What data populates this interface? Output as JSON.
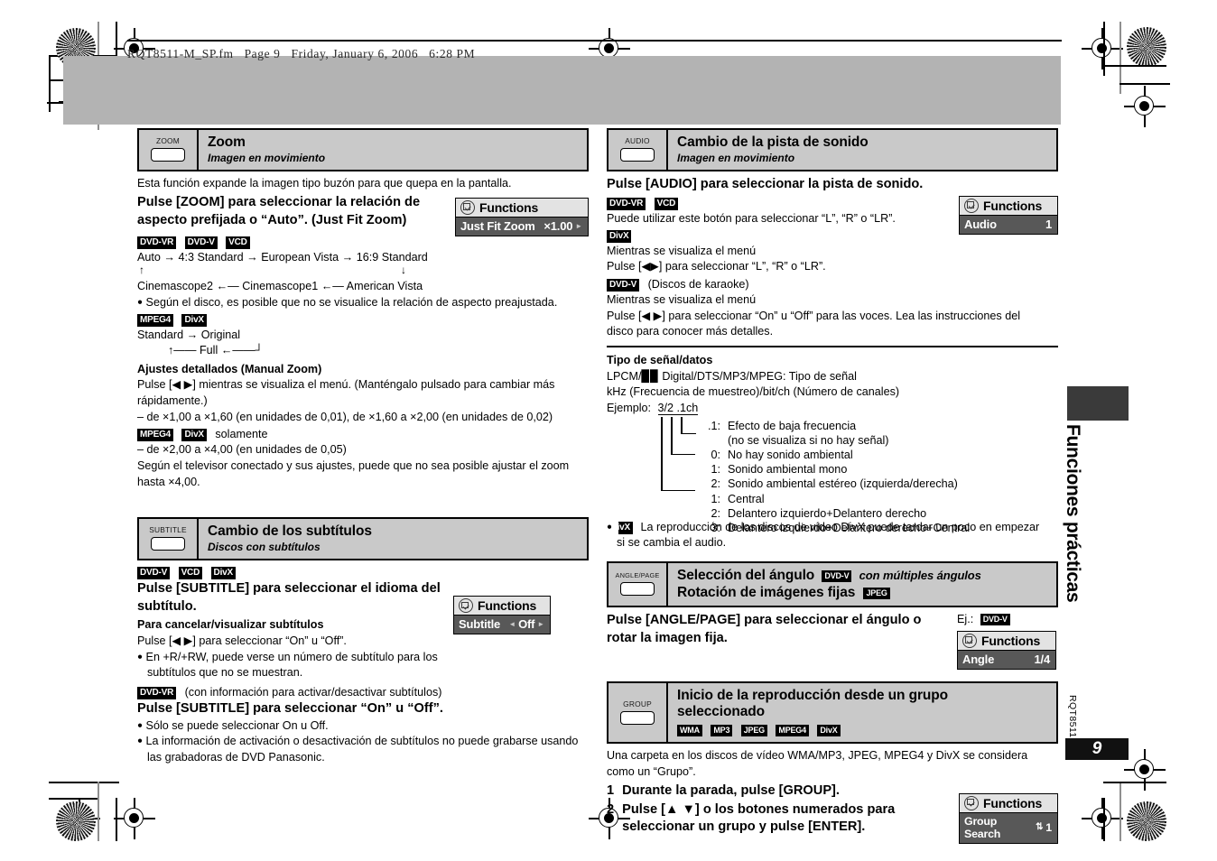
{
  "print_header": {
    "text": "RQT8511-M_SP.fm   Page 9   Friday, January 6, 2006   6:28 PM"
  },
  "sidebar": {
    "running_title": "Funciones prácticas",
    "doc_code": "RQT8511",
    "page_number": "9"
  },
  "sections": {
    "zoom": {
      "button_label": "ZOOM",
      "title": "Zoom",
      "subtitle": "Imagen en movimiento",
      "intro": "Esta función expande la imagen tipo buzón para que quepa en la pantalla.",
      "instruction_line1": "Pulse [ZOOM] para seleccionar la relación de",
      "instruction_line2": "aspecto prefijada o “Auto”. (Just Fit Zoom)",
      "badges_1": [
        "DVD-VR",
        "DVD-V",
        "VCD"
      ],
      "flow_top": "Auto → 4:3 Standard → European Vista → 16:9 Standard",
      "flow_bottom": "Cinemascope2 ←— Cinemascope1 ←— American Vista",
      "note_disc": "Según el disco, es posible que no se visualice la relación de aspecto preajustada.",
      "badges_2": [
        "MPEG4",
        "DivX"
      ],
      "flow_mpeg_top": "Standard → Original",
      "flow_mpeg_bottom": "Full",
      "manual_heading": "Ajustes detallados (Manual Zoom)",
      "manual_line1": "Pulse [◀ ▶] mientras se visualiza el menú. (Manténgalo pulsado para cambiar más",
      "manual_line2": "rápidamente.)",
      "range_1": "– de ×1,00 a ×1,60 (en unidades de 0,01), de ×1,60 a ×2,00 (en unidades de 0,02)",
      "badges_3": [
        "MPEG4",
        "DivX"
      ],
      "badges_3_suffix": "solamente",
      "range_2": "– de ×2,00 a ×4,00 (en unidades de 0,05)",
      "tv_note_line1": "Según el televisor conectado y sus ajustes, puede que no sea posible ajustar el zoom",
      "tv_note_line2": "hasta ×4,00.",
      "osd": {
        "title": "Functions",
        "row_label": "Just Fit Zoom",
        "row_value": "×1.00",
        "right_arrow": "►"
      }
    },
    "subtitle": {
      "button_label": "SUBTITLE",
      "title": "Cambio de los subtítulos",
      "subtitle": "Discos con subtítulos",
      "badges_1": [
        "DVD-V",
        "VCD",
        "DivX"
      ],
      "instruction_line1": "Pulse [SUBTITLE] para seleccionar el idioma del",
      "instruction_line2": "subtítulo.",
      "cancel_heading": "Para cancelar/visualizar subtítulos",
      "cancel_text": "Pulse [◀ ▶] para seleccionar “On” u “Off”.",
      "note1_line1": "En +R/+RW, puede verse un número de subtítulo para los",
      "note1_line2": "subtítulos que no se muestran.",
      "badge_vr": "DVD-VR",
      "badge_vr_suffix": "(con información para activar/desactivar subtítulos)",
      "instruction2": "Pulse [SUBTITLE] para seleccionar “On” u “Off”.",
      "note2": "Sólo se puede seleccionar On u Off.",
      "note3_line1": "La información de activación o desactivación de subtítulos no puede grabarse usando",
      "note3_line2": "las grabadoras de DVD Panasonic.",
      "osd": {
        "title": "Functions",
        "row_label": "Subtitle",
        "row_value": "Off",
        "left_arrow": "◄",
        "right_arrow": "►"
      }
    },
    "audio": {
      "button_label": "AUDIO",
      "title": "Cambio de la pista de sonido",
      "subtitle": "Imagen en movimiento",
      "instruction": "Pulse [AUDIO] para seleccionar la pista de sonido.",
      "badges_1": [
        "DVD-VR",
        "VCD"
      ],
      "text_1": "Puede utilizar este botón para seleccionar “L”, “R” o “LR”.",
      "badge_divx": "DivX",
      "text_2": "Mientras se visualiza el menú",
      "text_3": "Pulse [◀▶] para seleccionar “L”, “R” o “LR”.",
      "badge_dvdv": "DVD-V",
      "badge_dvdv_suffix": "(Discos de karaoke)",
      "text_4": "Mientras se visualiza el menú",
      "text_5_line1": "Pulse [◀ ▶] para seleccionar “On” u “Off” para las voces. Lea las instrucciones del",
      "text_5_line2": "disco para conocer más detalles.",
      "osd": {
        "title": "Functions",
        "row_label": "Audio",
        "row_value": "1"
      },
      "signal": {
        "heading": "Tipo de señal/datos",
        "line1": "LPCM/▉▉ Digital/DTS/MP3/MPEG:  Tipo de señal",
        "line2": "kHz (Frecuencia de muestreo)/bit/ch (Número de canales)",
        "example_label": "Ejemplo:",
        "example_value": "3/2 .1ch",
        "rows": [
          {
            "key": ".1:",
            "desc": "Efecto de baja frecuencia"
          },
          {
            "key": "",
            "desc": "(no se visualiza si no hay señal)"
          },
          {
            "key": "0:",
            "desc": "No hay sonido ambiental"
          },
          {
            "key": "1:",
            "desc": "Sonido ambiental mono"
          },
          {
            "key": "2:",
            "desc": "Sonido ambiental estéreo (izquierda/derecha)"
          },
          {
            "key": "1:",
            "desc": "Central"
          },
          {
            "key": "2:",
            "desc": "Delantero izquierdo+Delantero derecho"
          },
          {
            "key": "3:",
            "desc": "Delantero izquierdo+Delantero derecho+Central"
          }
        ],
        "divx_badge": "DivX",
        "divx_note_line1": "La reproducción de los discos de vídeo DivX puede tardar un poco en empezar",
        "divx_note_line2": "si se cambia el audio."
      }
    },
    "angle": {
      "button_label": "ANGLE/PAGE",
      "title_line1_a": "Selección del ángulo",
      "title_line1_badge": "DVD-V",
      "title_line1_b": "con múltiples ángulos",
      "title_line2_a": "Rotación de imágenes fijas",
      "title_line2_badge": "JPEG",
      "instruction_line1": "Pulse [ANGLE/PAGE] para seleccionar el ángulo o",
      "instruction_line2": "rotar la imagen fija.",
      "example_label": "Ej.:",
      "example_badge": "DVD-V",
      "osd": {
        "title": "Functions",
        "row_label": "Angle",
        "row_value": "1/4"
      }
    },
    "group": {
      "button_label": "GROUP",
      "title_line1": "Inicio de la reproducción desde un grupo",
      "title_line2": "seleccionado",
      "badges": [
        "WMA",
        "MP3",
        "JPEG",
        "MPEG4",
        "DivX"
      ],
      "intro_line1": "Una carpeta en los discos de vídeo WMA/MP3, JPEG, MPEG4 y DivX se considera",
      "intro_line2": "como un “Grupo”.",
      "step1_num": "1",
      "step1_text": "Durante la parada, pulse [GROUP].",
      "step2_num": "2",
      "step2_line1": "Pulse [▲ ▼] o los botones numerados para",
      "step2_line2": "seleccionar un grupo y pulse [ENTER].",
      "osd": {
        "title": "Functions",
        "row_label": "Group Search",
        "row_value": "1",
        "spinner": "⇅"
      }
    }
  }
}
